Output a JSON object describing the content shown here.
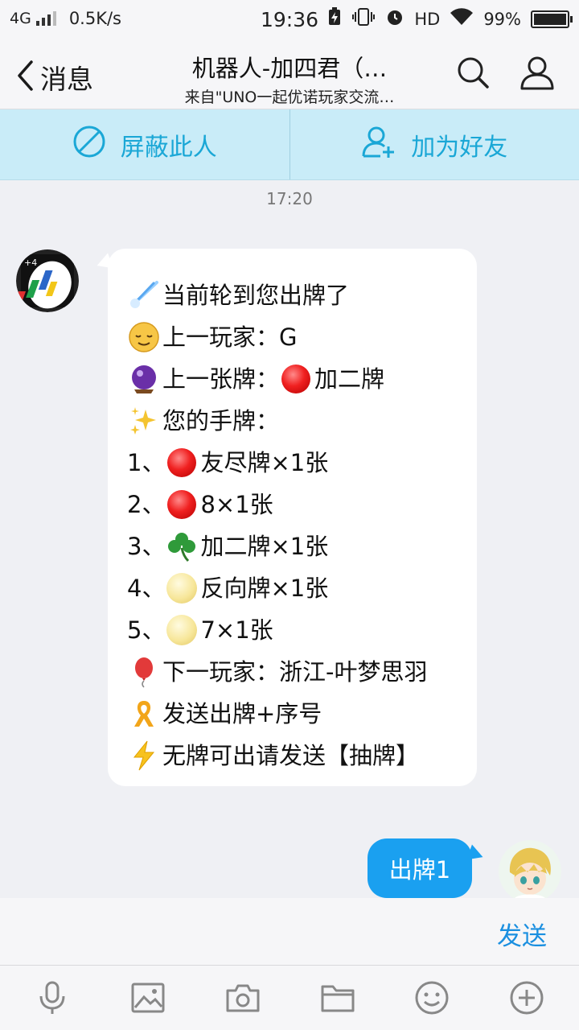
{
  "status_bar": {
    "network": "4G",
    "speed": "0.5K/s",
    "time": "19:36",
    "hd": "HD",
    "battery": "99%",
    "battery_level": 0.99
  },
  "nav": {
    "back_label": "消息",
    "title": "机器人-加四君（…",
    "subtitle": "来自\"UNO一起优诺玩家交流…"
  },
  "actions": {
    "block_label": "屏蔽此人",
    "add_friend_label": "加为好友"
  },
  "chat": {
    "timestamp": "17:20",
    "bot_message": {
      "lines": [
        {
          "icon": "comet-icon",
          "text": "当前轮到您出牌了"
        },
        {
          "icon": "relieved-face-icon",
          "text": "上一玩家：G"
        },
        {
          "icon": "crystal-ball-icon",
          "text": "上一张牌：",
          "icon2": "red-circle-icon",
          "text2": "加二牌"
        },
        {
          "icon": "sparkles-icon",
          "text": "您的手牌："
        },
        {
          "prefix": "1、",
          "icon": "red-circle-icon",
          "text": "友尽牌×1张"
        },
        {
          "prefix": "2、",
          "icon": "red-circle-icon",
          "text": "8×1张"
        },
        {
          "prefix": "3、",
          "icon": "shamrock-icon",
          "text": "加二牌×1张"
        },
        {
          "prefix": "4、",
          "icon": "full-moon-icon",
          "text": "反向牌×1张"
        },
        {
          "prefix": "5、",
          "icon": "full-moon-icon",
          "text": "7×1张"
        },
        {
          "icon": "balloon-icon",
          "text": "下一玩家：浙江-叶梦思羽"
        },
        {
          "icon": "ribbon-icon",
          "text": "发送出牌+序号"
        },
        {
          "icon": "lightning-icon",
          "text": "无牌可出请发送【抽牌】"
        }
      ]
    },
    "user_message": "出牌1"
  },
  "input": {
    "send_label": "发送"
  },
  "toolbar": {
    "icons": [
      "microphone-icon",
      "image-icon",
      "camera-icon",
      "folder-icon",
      "emoji-icon",
      "plus-icon"
    ]
  },
  "colors": {
    "accent": "#1aa0f0",
    "action_bar_bg": "#c9ecf8",
    "action_text": "#1aa7d6",
    "chat_bg": "#eff0f4"
  }
}
